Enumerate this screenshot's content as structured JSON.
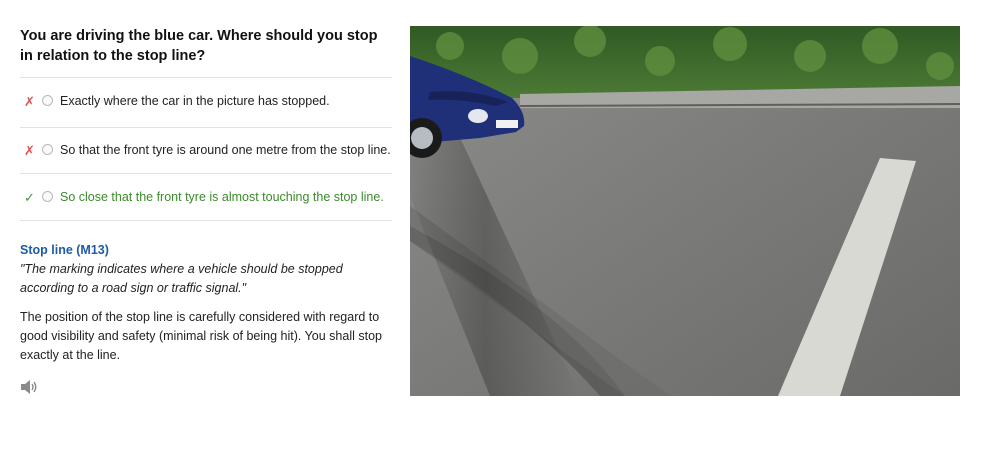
{
  "question": "You are driving the blue car. Where should you stop in relation to the stop line?",
  "answers": [
    {
      "text": "Exactly where the car in the picture has stopped.",
      "mark": "✗",
      "status": "wrong"
    },
    {
      "text": "So that the front tyre is around one metre from the stop line.",
      "mark": "✗",
      "status": "wrong"
    },
    {
      "text": "So close that the front tyre is almost touching the stop line.",
      "mark": "✓",
      "status": "correct"
    }
  ],
  "explanation": {
    "title": "Stop line (M13)",
    "quote": "\"The marking indicates where a vehicle should be stopped according to a road sign or traffic signal.\"",
    "body": "The position of the stop line is carefully considered with regard to good visibility and safety (minimal risk of being hit). You shall stop exactly at the line."
  },
  "icons": {
    "wrong": "cross-mark-icon",
    "correct": "check-mark-icon",
    "audio": "speaker-icon"
  },
  "colors": {
    "wrong": "#d9534f",
    "correct": "#3c8a2c",
    "title": "#1f5aa8"
  }
}
